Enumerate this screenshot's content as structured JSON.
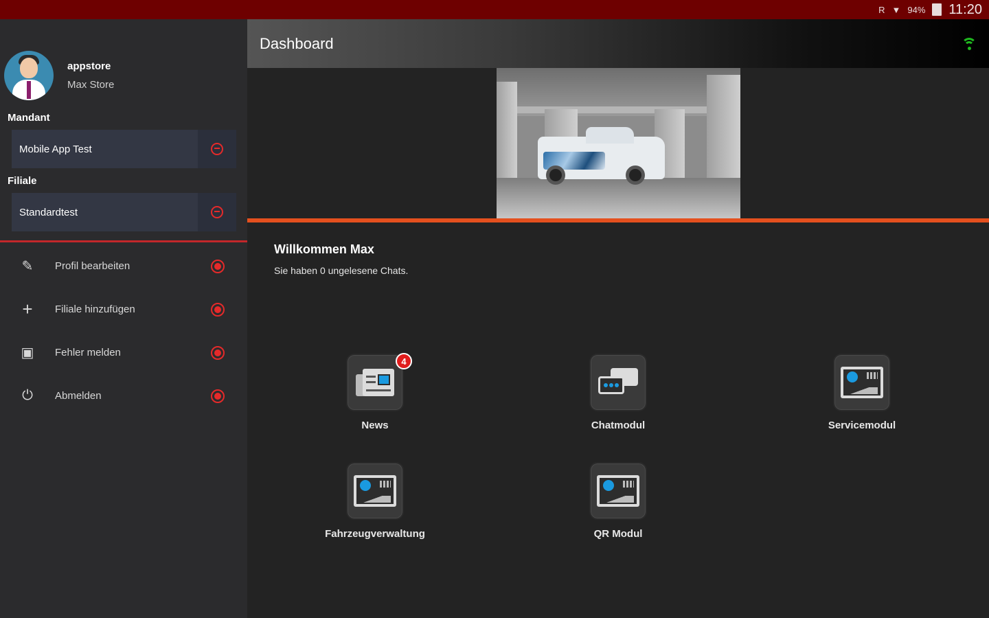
{
  "status_bar": {
    "signal_text": "R",
    "battery": "94%",
    "time": "11:20"
  },
  "profile": {
    "name": "appstore",
    "store": "Max Store"
  },
  "mandant": {
    "label": "Mandant",
    "value": "Mobile App Test"
  },
  "filiale": {
    "label": "Filiale",
    "value": "Standardtest"
  },
  "menu": [
    {
      "label": "Profil bearbeiten",
      "icon": "pencil-icon"
    },
    {
      "label": "Filiale hinzufügen",
      "icon": "plus-icon"
    },
    {
      "label": "Fehler melden",
      "icon": "message-icon"
    },
    {
      "label": "Abmelden",
      "icon": "power-icon"
    }
  ],
  "appbar": {
    "title": "Dashboard"
  },
  "welcome": {
    "title": "Willkommen Max",
    "subtitle": "Sie haben 0 ungelesene Chats."
  },
  "tiles": [
    {
      "label": "News",
      "badge": "4",
      "icon": "news-icon"
    },
    {
      "label": "Chatmodul",
      "icon": "chat-icon"
    },
    {
      "label": "Servicemodul",
      "icon": "stats-icon"
    },
    {
      "label": "Fahrzeugverwaltung",
      "icon": "stats-icon"
    },
    {
      "label": "QR Modul",
      "icon": "stats-icon"
    }
  ],
  "colors": {
    "accent_red": "#e52a2a",
    "orange": "#e4501e",
    "status_bar": "#6e0000",
    "wifi_green": "#1fb81f",
    "icon_blue": "#1a9ae0"
  }
}
